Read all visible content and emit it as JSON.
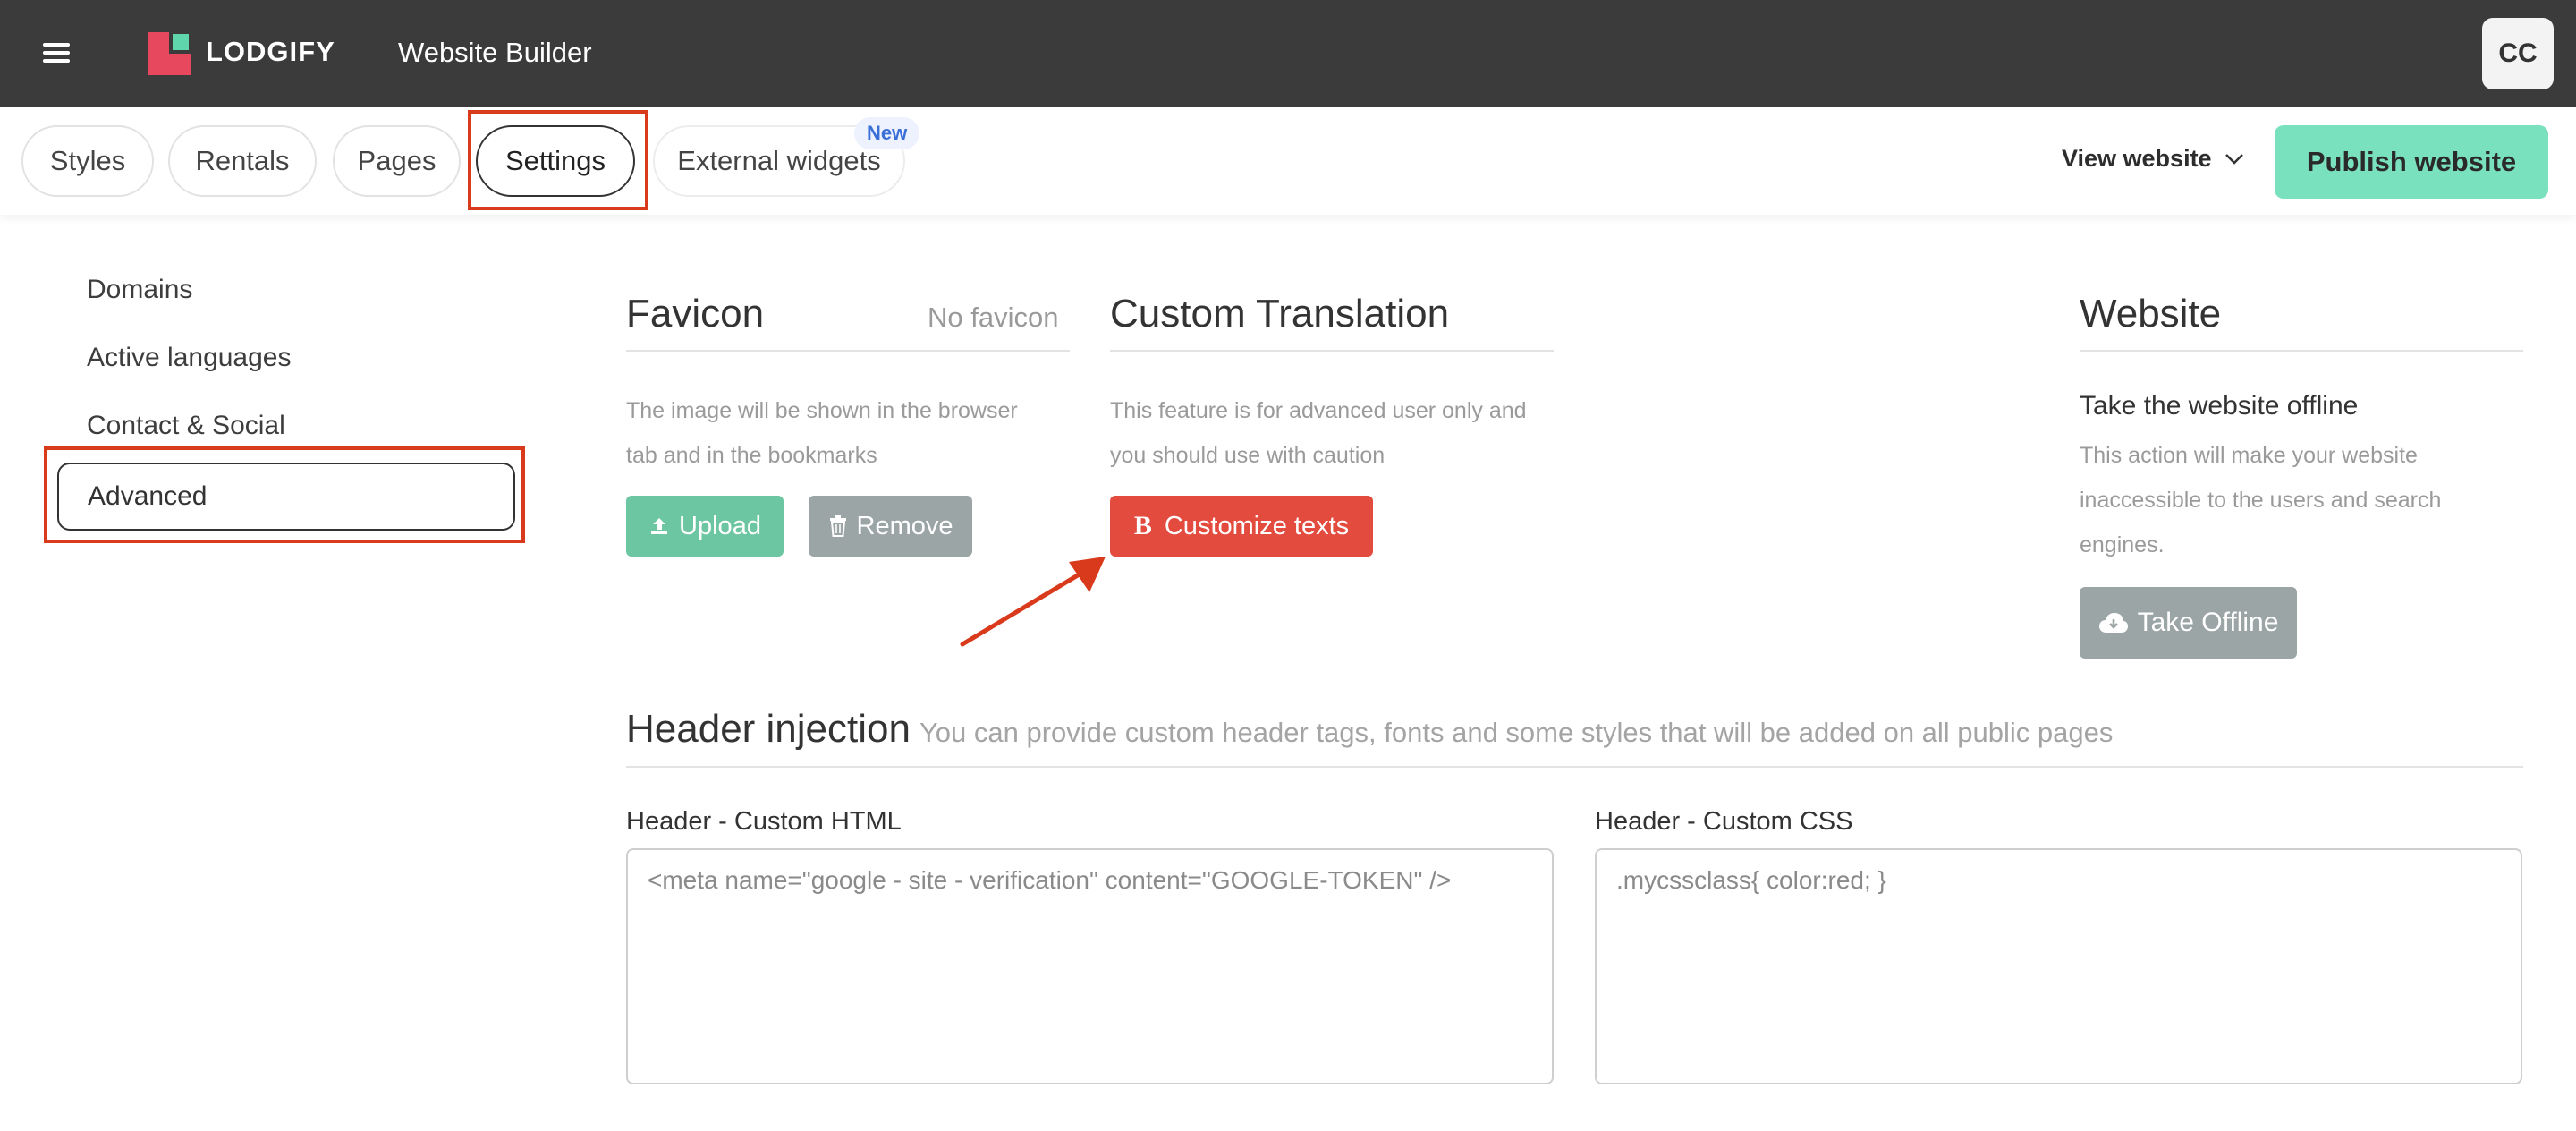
{
  "header": {
    "brand": "LODGIFY",
    "app_title": "Website Builder",
    "avatar_initials": "CC",
    "logo_colors": {
      "primary": "#e8485e",
      "accent": "#5fd6ac"
    }
  },
  "tabs": [
    {
      "label": "Styles"
    },
    {
      "label": "Rentals"
    },
    {
      "label": "Pages"
    },
    {
      "label": "Settings",
      "active": true
    },
    {
      "label": "External widgets",
      "badge": "New"
    }
  ],
  "toolbar": {
    "view_website": "View website",
    "publish": "Publish website"
  },
  "sidebar": {
    "items": [
      {
        "label": "Domains"
      },
      {
        "label": "Active languages"
      },
      {
        "label": "Contact & Social"
      },
      {
        "label": "Advanced",
        "active": true
      }
    ]
  },
  "favicon": {
    "title": "Favicon",
    "status": "No favicon",
    "desc_line1": "The image will be shown in the browser",
    "desc_line2": "tab and in the bookmarks",
    "upload_label": "Upload",
    "remove_label": "Remove"
  },
  "translation": {
    "title": "Custom Translation",
    "desc_line1": "This feature is for advanced user only and",
    "desc_line2": "you should use with caution",
    "customize_label": "Customize texts",
    "customize_icon_letter": "B"
  },
  "website": {
    "title": "Website",
    "offline_title": "Take the website offline",
    "desc_line1": "This action will make your website",
    "desc_line2": "inaccessible to the users and search",
    "desc_line3": "engines.",
    "offline_label": "Take Offline"
  },
  "header_injection": {
    "title": "Header injection",
    "subtitle": "You can provide custom header tags, fonts and some styles that will be added on all public pages",
    "html_label": "Header - Custom HTML",
    "html_placeholder": "<meta name=\"google - site - verification\" content=\"GOOGLE-TOKEN\" />",
    "css_label": "Header - Custom CSS",
    "css_placeholder": ".mycssclass{ color:red; }"
  },
  "colors": {
    "annotation": "#d93a1c",
    "publish": "#7ae1bf",
    "upload": "#6dc6a2",
    "customize": "#e34b3f",
    "neutral_button": "#9ca5a6"
  }
}
